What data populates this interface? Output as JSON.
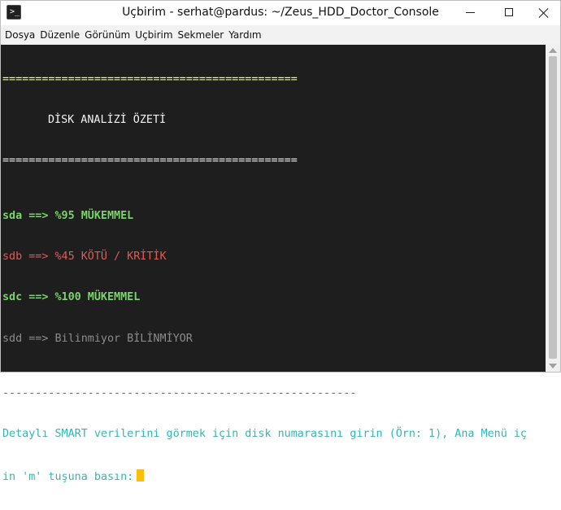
{
  "window": {
    "title": "Uçbirim - serhat@pardus: ~/Zeus_HDD_Doctor_Console",
    "icon_prompt": ">_"
  },
  "menu": {
    "items": [
      "Dosya",
      "Düzenle",
      "Görünüm",
      "Uçbirim",
      "Sekmeler",
      "Yardım"
    ]
  },
  "terminal": {
    "separator_top": "=============================================",
    "summary_title": "DİSK ANALİZİ ÖZETİ",
    "separator_bottom": "=============================================",
    "disks": [
      {
        "name": "sda",
        "arrow": "==>",
        "status": "%95 MÜKEMMEL",
        "color": "#7ad36b"
      },
      {
        "name": "sdb",
        "arrow": "==>",
        "status": "%45 KÖTÜ / KRİTİK",
        "color": "#e05a56"
      },
      {
        "name": "sdc",
        "arrow": "==>",
        "status": "%100 MÜKEMMEL",
        "color": "#7ad36b"
      },
      {
        "name": "sdd",
        "arrow": "==>",
        "status": "Bilinmiyor BİLİNMİYOR",
        "color": "#8b8b8b"
      }
    ],
    "dash_line": "------------------------------------------------------",
    "prompt_line1": "Detaylı SMART verilerini görmek için disk numarasını girin (Örn: 1), Ana Menü iç",
    "prompt_line2": "in 'm' tuşuna basın:",
    "cursor_color": "#f8c000"
  }
}
